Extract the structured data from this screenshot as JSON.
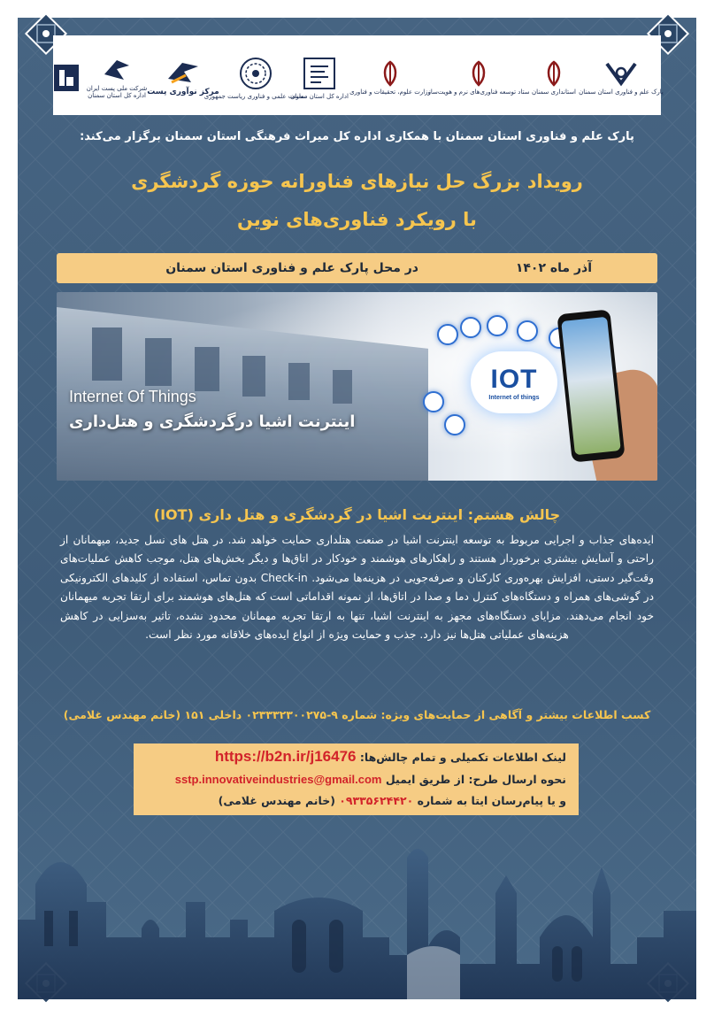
{
  "logos": [
    {
      "name": "park-logo",
      "caption": "پارک علم و فناوری استان سمنان"
    },
    {
      "name": "governorate-logo",
      "caption": "استانداری سمنان"
    },
    {
      "name": "vice-presidency-logo",
      "caption": "ستاد توسعه فناوری‌های نرم و هویت‌ساز"
    },
    {
      "name": "ministry-science-logo",
      "caption": "وزارت علوم، تحقیقات و فناوری"
    },
    {
      "name": "heritage-logo",
      "caption": "اداره کل استان سمنان"
    },
    {
      "name": "innovation-logo",
      "caption": "معاونت علمی و فناوری ریاست جمهوری"
    },
    {
      "name": "post-innovation-logo",
      "caption": "مرکز نوآوری پست"
    },
    {
      "name": "iran-post-logo",
      "caption": "شرکت ملی پست ایران اداره کل استان سمنان"
    },
    {
      "name": "institute-logo",
      "caption": ""
    }
  ],
  "intro": "پارک علم و فناوری استان سمنان با همکاری اداره کل میراث فرهنگی استان سمنان برگزار می‌کند:",
  "headline": {
    "line1": "رویداد بزرگ حل نیازهای فناورانه حوزه گردشگری",
    "line2": "با رویکرد فناوری‌های نوین"
  },
  "date_band": {
    "date": "آذر ماه ۱۴۰۲",
    "place": "در محل پارک علم و فناوری استان سمنان"
  },
  "banner": {
    "english_title": "Internet Of Things",
    "persian_title": "اینترنت اشیا درگردشگری و هتل‌داری",
    "iot_big": "IOT",
    "iot_small": "Internet of things"
  },
  "challenge_title": "چالش هشتم: اینترنت اشیا در گردشگری و هتل داری (IOT)",
  "body": "ایده‌های جذاب و اجرایی مربوط به توسعه اینترنت اشیا در صنعت هتلداری حمایت خواهد شد. در هتل های نسل جدید، میهمانان از راحتی و آسایش بیشتری برخوردار هستند و راهکارهای هوشمند و خودکار در اتاق‌ها و دیگر بخش‌های هتل، موجب کاهش عملیات‌های وقت‌گیر دستی، افزایش بهره‌وری کارکنان و صرفه‌جویی در هزینه‌ها می‌شود. Check-in بدون تماس، استفاده از کلیدهای الکترونیکی در گوشی‌های همراه و دستگاه‌های کنترل دما و صدا در اتاق‌ها، از نمونه اقداماتی است که هتل‌های هوشمند برای ارتقا تجربه میهمانان خود انجام می‌دهند. مزایای دستگاه‌های مجهز به اینترنت اشیا، تنها به ارتقا تجربه مهمانان محدود نشده، تاثیر به‌سزایی در کاهش هزینه‌های عملیاتی هتل‌ها نیز دارد. جذب و حمایت ویژه از انواع ایده‌های خلاقانه مورد نظر است.",
  "contact": "کسب اطلاعات بیشتر و آگاهی از حمایت‌های ویژه: شماره ۹-۰۲۳۳۳۲۳۰۰۲۷۵ داخلی ۱۵۱ (خانم مهندس غلامی)",
  "link_box": {
    "label": "لینک اطلاعات تکمیلی و تمام چالش‌ها:",
    "url": "https://b2n.ir/j16476",
    "submit_label": "نحوه ارسال طرح: از طریق ایمیل",
    "email": "sstp.innovativeindustries@gmail.com",
    "messenger_label": "و یا پیام‌رسان ایتا به شماره",
    "phone": "۰۹۳۳۵۶۲۴۴۲۰",
    "phone_note": "(خانم مهندس غلامی)"
  },
  "colors": {
    "background": "#466482",
    "accent": "#f6c54f",
    "band": "#f6cc84",
    "link": "#d2232a"
  }
}
